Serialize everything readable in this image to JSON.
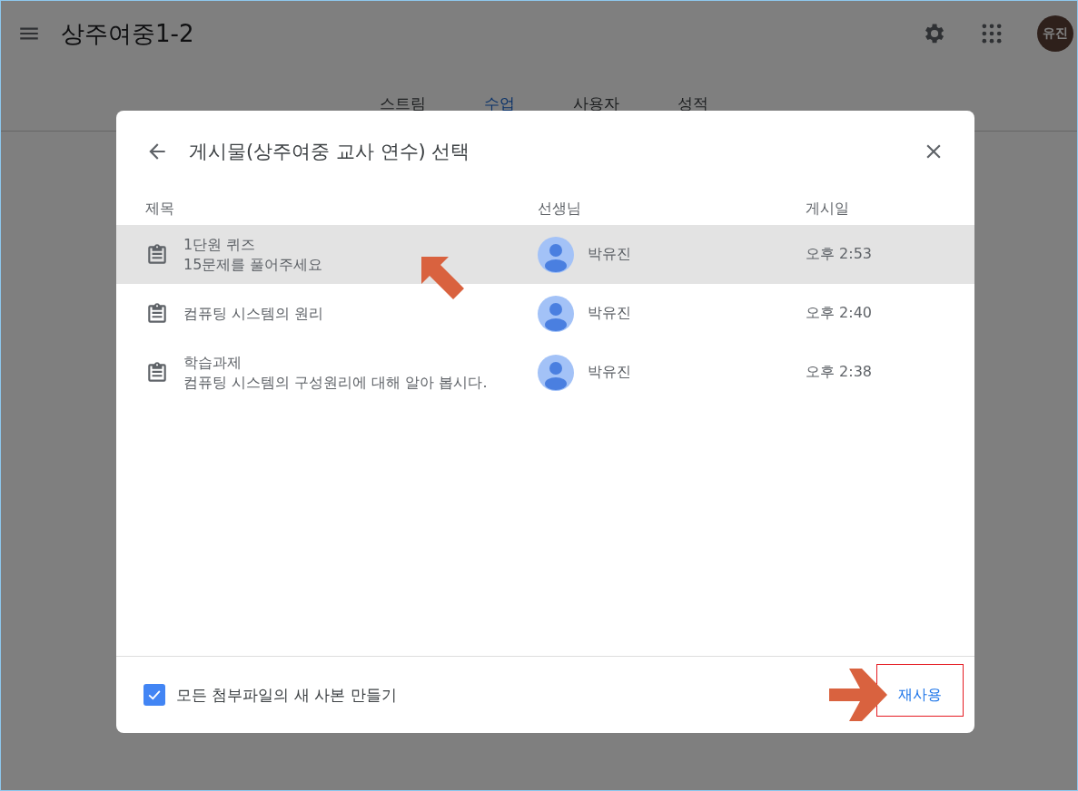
{
  "app_bar": {
    "title": "상주여중1-2",
    "avatar": "유진"
  },
  "tabs": [
    {
      "label": "스트림",
      "selected": false
    },
    {
      "label": "수업",
      "selected": true
    },
    {
      "label": "사용자",
      "selected": false
    },
    {
      "label": "성적",
      "selected": false
    }
  ],
  "dialog": {
    "title": "게시물(상주여중 교사 연수) 선택",
    "columns": [
      "제목",
      "선생님",
      "게시일"
    ],
    "rows": [
      {
        "title": "1단원 퀴즈",
        "subtitle": "15문제를 풀어주세요",
        "teacher": "박유진",
        "posted": "오후 2:53",
        "selected": true
      },
      {
        "title": "컴퓨팅 시스템의 원리",
        "teacher": "박유진",
        "posted": "오후 2:40",
        "selected": false
      },
      {
        "title": "학습과제",
        "subtitle": "컴퓨팅 시스템의 구성원리에 대해 알아 봅시다.",
        "teacher": "박유진",
        "posted": "오후 2:38",
        "selected": false
      }
    ],
    "copy_attachments": {
      "label": "모든 첨부파일의 새 사본 만들기",
      "checked": true
    },
    "action": "재사용"
  }
}
